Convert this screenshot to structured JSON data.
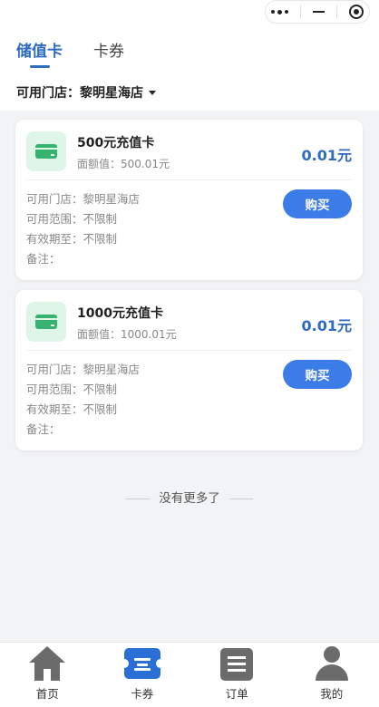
{
  "tabs": [
    {
      "label": "储值卡",
      "active": true
    },
    {
      "label": "卡券",
      "active": false
    }
  ],
  "store_selector": {
    "label": "可用门店：黎明星海店"
  },
  "cards": [
    {
      "title": "500元充值卡",
      "face_value": "面额值：500.01元",
      "price": "0.01元",
      "store": "可用门店：黎明星海店",
      "scope": "可用范围：不限制",
      "expiry": "有效期至：不限制",
      "note": "备注：",
      "buy_label": "购买"
    },
    {
      "title": "1000元充值卡",
      "face_value": "面额值：1000.01元",
      "price": "0.01元",
      "store": "可用门店：黎明星海店",
      "scope": "可用范围：不限制",
      "expiry": "有效期至：不限制",
      "note": "备注：",
      "buy_label": "购买"
    }
  ],
  "end_text": "没有更多了",
  "tabbar": [
    {
      "label": "首页",
      "icon": "home-icon"
    },
    {
      "label": "卡券",
      "icon": "ticket-icon",
      "active": true
    },
    {
      "label": "订单",
      "icon": "order-list-icon"
    },
    {
      "label": "我的",
      "icon": "user-icon"
    }
  ],
  "colors": {
    "accent": "#2f6bbf",
    "button": "#3b7ce8",
    "card_icon_bg": "#dff5e8",
    "card_icon": "#36b36e",
    "active_tab_icon": "#2a6fd6",
    "inactive_icon": "#6b6b6b"
  }
}
